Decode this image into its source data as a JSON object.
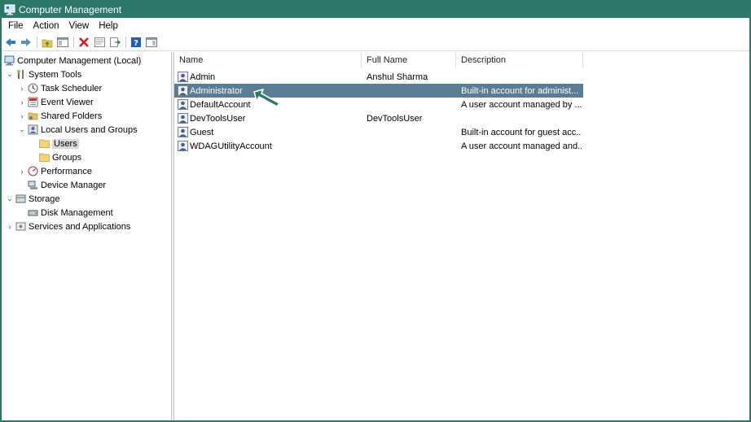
{
  "window": {
    "title": "Computer Management"
  },
  "menu": [
    "File",
    "Action",
    "View",
    "Help"
  ],
  "toolbar": {
    "buttons": [
      "back-arrow-icon",
      "forward-arrow-icon",
      "up-folder-icon",
      "show-hide-tree-icon",
      "delete-icon",
      "properties-icon",
      "export-icon",
      "help-icon",
      "console-view-icon"
    ]
  },
  "tree": {
    "root": "Computer Management (Local)",
    "system_tools": "System Tools",
    "task_scheduler": "Task Scheduler",
    "event_viewer": "Event Viewer",
    "shared_folders": "Shared Folders",
    "local_users_groups": "Local Users and Groups",
    "users": "Users",
    "groups": "Groups",
    "performance": "Performance",
    "device_manager": "Device Manager",
    "storage": "Storage",
    "disk_management": "Disk Management",
    "services_apps": "Services and Applications"
  },
  "list": {
    "columns": [
      "Name",
      "Full Name",
      "Description"
    ],
    "rows": [
      {
        "name": "Admin",
        "full_name": "Anshul Sharma",
        "description": ""
      },
      {
        "name": "Administrator",
        "full_name": "",
        "description": "Built-in account for administ..."
      },
      {
        "name": "DefaultAccount",
        "full_name": "",
        "description": "A user account managed by ..."
      },
      {
        "name": "DevToolsUser",
        "full_name": "DevToolsUser",
        "description": ""
      },
      {
        "name": "Guest",
        "full_name": "",
        "description": "Built-in account for guest acc..."
      },
      {
        "name": "WDAGUtilityAccount",
        "full_name": "",
        "description": "A user account managed and..."
      }
    ],
    "selected_row": "Administrator"
  },
  "colors": {
    "title_bar": "#2d7768",
    "selection": "#5a7d94",
    "pointer_arrow": "#2d7768"
  }
}
